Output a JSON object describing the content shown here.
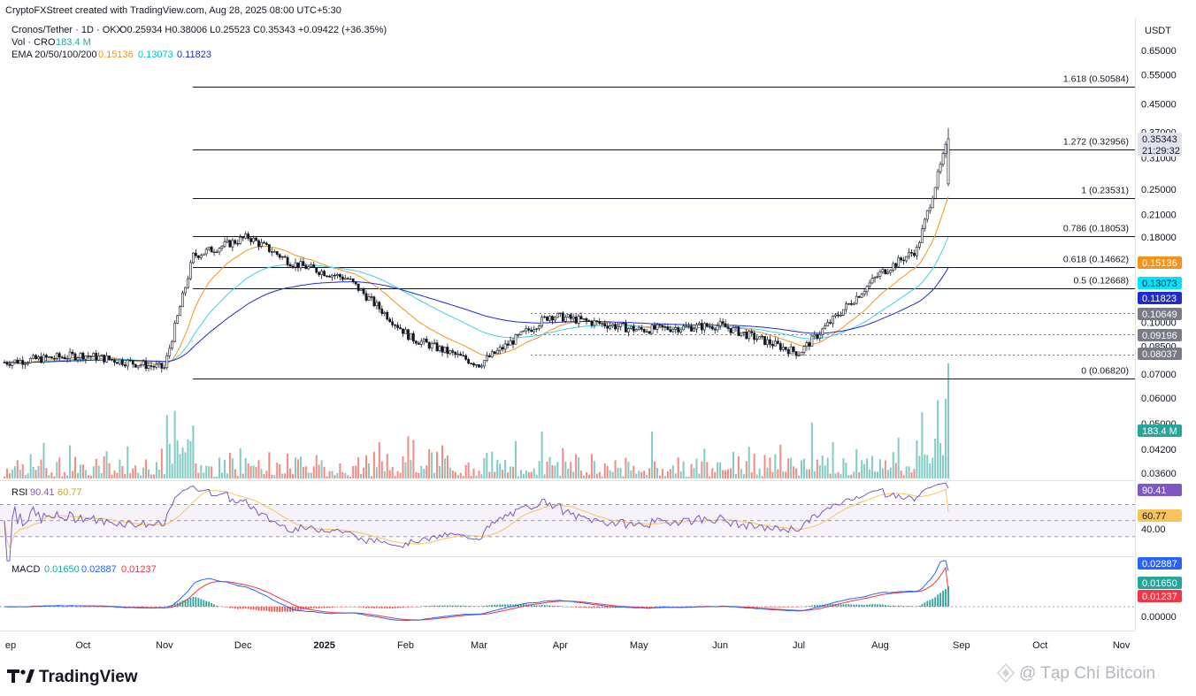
{
  "header": {
    "credit": "CryptoFXStreet created with TradingView.com, Aug 28, 2025 08:00 UTC+5:30",
    "symbol": "Cronos/Tether · 1D · OKX",
    "ohlc": "O0.25934 H0.38006 L0.25523 C0.35343 +0.09422 (+36.35%)",
    "vol_label": "Vol · CRO",
    "vol_value": "183.4 M",
    "ema_label": "EMA 20/50/100/200",
    "ema20": "0.15136",
    "ema50": "0.13073",
    "ema100": "0.11823",
    "currency": "USDT"
  },
  "colors": {
    "up": "#26a69a",
    "down": "#ef5350",
    "vol_up": "#80cbc4",
    "vol_down": "#f28b82",
    "ema20": "#f7931a",
    "ema50": "#3fd0e8",
    "ema100": "#1f2bd1",
    "rsi_line": "#7e57c2",
    "rsi_ma": "#f7c35a",
    "macd_line": "#2962ff",
    "signal_line": "#f23645",
    "fib_line": "#131722"
  },
  "chart_data": [
    {
      "type": "candlestick",
      "title": "Cronos/Tether · 1D · OKX",
      "y_scale": "log",
      "x_ticks": [
        "ep",
        "Oct",
        "Nov",
        "Dec",
        "2025",
        "Feb",
        "Mar",
        "Apr",
        "May",
        "Jun",
        "Jul",
        "Aug",
        "Sep",
        "Oct",
        "Nov"
      ],
      "y_ticks": [
        "0.65000",
        "0.55000",
        "0.45000",
        "0.37000",
        "0.31000",
        "0.25000",
        "0.21000",
        "0.18000",
        "0.10000",
        "0.08500",
        "0.07000",
        "0.06000",
        "0.05000",
        "0.04200",
        "0.03600"
      ],
      "ohlc_last": {
        "open": 0.25934,
        "high": 0.38006,
        "low": 0.25523,
        "close": 0.35343,
        "change": 0.09422,
        "change_pct": 36.35
      },
      "approx_close_path": [
        {
          "date": "2024-09",
          "close": 0.076
        },
        {
          "date": "2024-10-01",
          "close": 0.08
        },
        {
          "date": "2024-11-01",
          "close": 0.073
        },
        {
          "date": "2024-11-12",
          "close": 0.158
        },
        {
          "date": "2024-12-03",
          "close": 0.18
        },
        {
          "date": "2024-12-20",
          "close": 0.15
        },
        {
          "date": "2025-01-10",
          "close": 0.135
        },
        {
          "date": "2025-02-03",
          "close": 0.09
        },
        {
          "date": "2025-03-01",
          "close": 0.075
        },
        {
          "date": "2025-03-28",
          "close": 0.105
        },
        {
          "date": "2025-05-01",
          "close": 0.095
        },
        {
          "date": "2025-06-01",
          "close": 0.098
        },
        {
          "date": "2025-07-01",
          "close": 0.081
        },
        {
          "date": "2025-08-01",
          "close": 0.14
        },
        {
          "date": "2025-08-15",
          "close": 0.165
        },
        {
          "date": "2025-08-27",
          "close": 0.35343
        }
      ],
      "fib_levels": [
        {
          "label": "1.618 (0.50584)",
          "value": 0.50584
        },
        {
          "label": "1.272 (0.32956)",
          "value": 0.32956
        },
        {
          "label": "1 (0.23531)",
          "value": 0.23531
        },
        {
          "label": "0.786 (0.18053)",
          "value": 0.18053
        },
        {
          "label": "0.618 (0.14662)",
          "value": 0.14662
        },
        {
          "label": "0.5 (0.12668)",
          "value": 0.12668
        },
        {
          "label": "0 (0.06820)",
          "value": 0.0682
        }
      ],
      "dotted_levels": [
        0.10649,
        0.09196,
        0.08037
      ],
      "price_tags": [
        {
          "text": "0.35343",
          "value": 0.35343,
          "bg": "#e0e3eb",
          "fg": "#131722"
        },
        {
          "text": "21:29:32",
          "value": 0.335,
          "bg": "#e0e3eb",
          "fg": "#131722"
        },
        {
          "text": "0.15136",
          "value": 0.15136,
          "bg": "#f7931a",
          "fg": "#ffffff"
        },
        {
          "text": "0.13073",
          "value": 0.13073,
          "bg": "#00e5ff",
          "fg": "#131722"
        },
        {
          "text": "0.11823",
          "value": 0.11823,
          "bg": "#1f2bd1",
          "fg": "#ffffff"
        },
        {
          "text": "0.10649",
          "value": 0.10649,
          "bg": "#787b86",
          "fg": "#ffffff"
        },
        {
          "text": "0.09196",
          "value": 0.09196,
          "bg": "#787b86",
          "fg": "#ffffff"
        },
        {
          "text": "0.08037",
          "value": 0.08037,
          "bg": "#787b86",
          "fg": "#ffffff"
        }
      ],
      "volume_tag": "183.4 M"
    },
    {
      "type": "line",
      "title": "RSI",
      "rsi": "90.41",
      "rsi_ma": "60.77",
      "y_ticks": [
        "40.00"
      ],
      "bands": [
        30,
        70
      ],
      "tags": [
        {
          "text": "90.41",
          "bg": "#7e57c2"
        },
        {
          "text": "60.77",
          "bg": "#f7c35a"
        }
      ]
    },
    {
      "type": "line",
      "title": "MACD",
      "macd": "0.01650",
      "signal": "0.02887",
      "hist": "0.01237",
      "y_ticks": [
        "0.00000"
      ],
      "tags": [
        {
          "text": "0.02887",
          "bg": "#2962ff"
        },
        {
          "text": "0.01650",
          "bg": "#26a69a"
        },
        {
          "text": "0.01237",
          "bg": "#f23645"
        }
      ]
    }
  ],
  "footer": {
    "brand": "TradingView",
    "watermark": "@ Tạp Chí Bitcoin"
  }
}
